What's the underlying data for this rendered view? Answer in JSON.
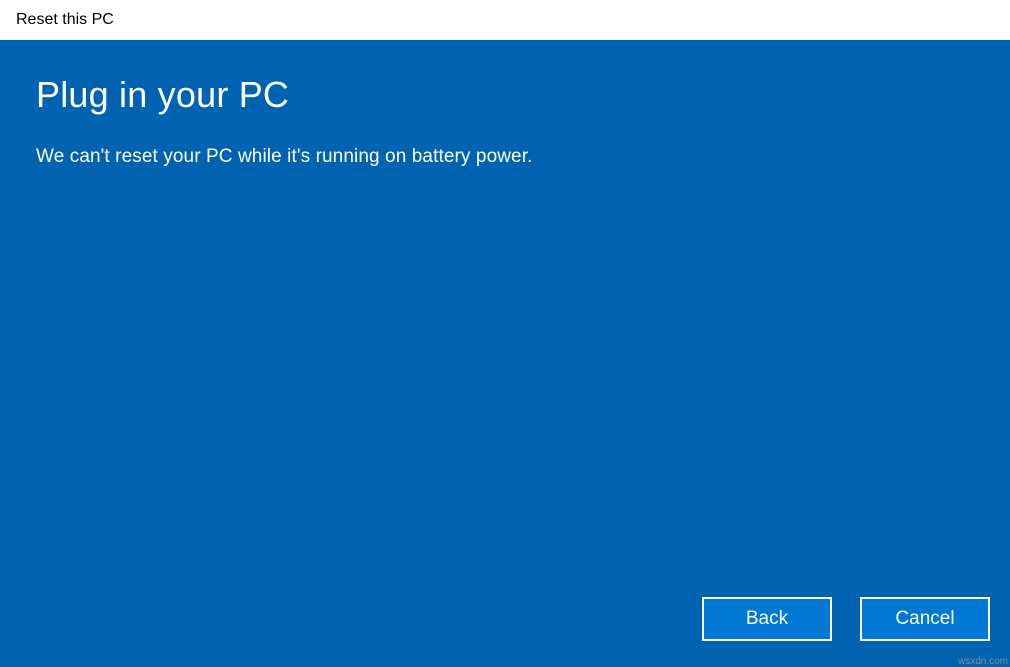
{
  "window": {
    "title": "Reset this PC"
  },
  "main": {
    "heading": "Plug in your PC",
    "body": "We can't reset your PC while it's running on battery power."
  },
  "buttons": {
    "back": "Back",
    "cancel": "Cancel"
  },
  "watermark": "wsxdn.com"
}
